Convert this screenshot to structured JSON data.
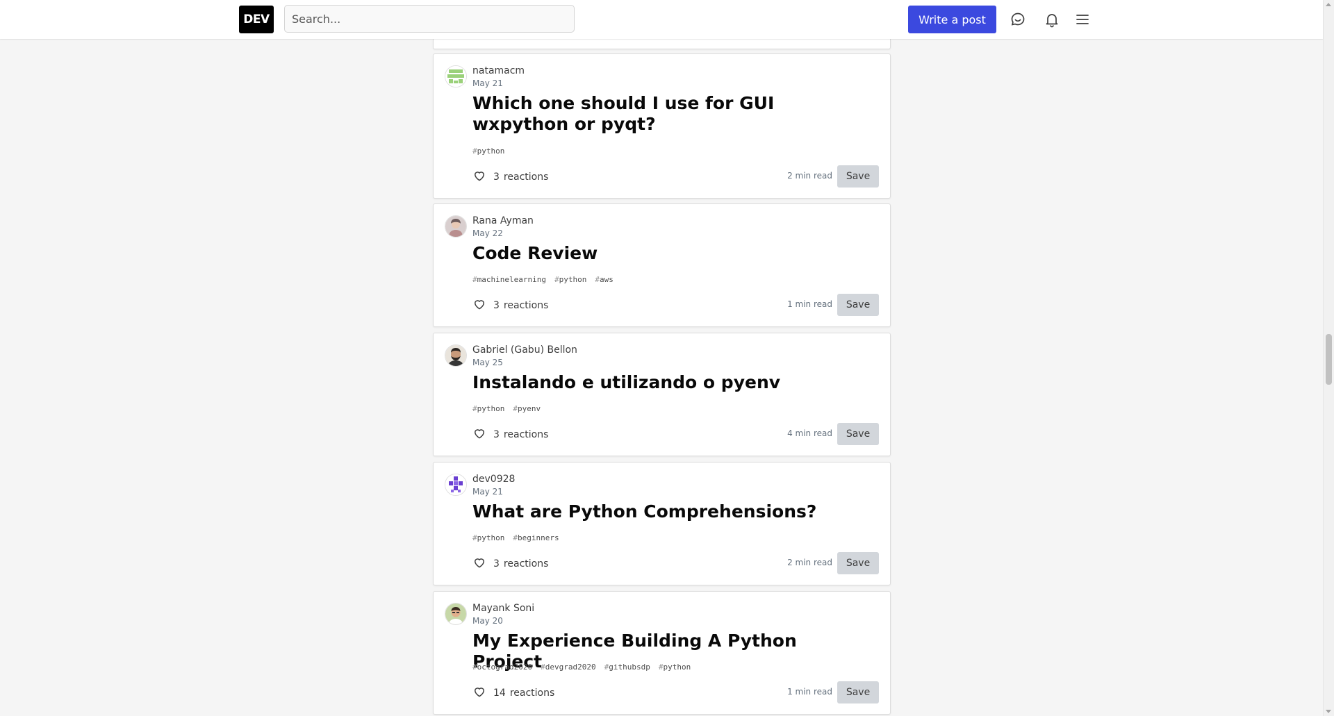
{
  "header": {
    "logo": "DEV",
    "search_placeholder": "Search...",
    "write_button": "Write a post",
    "icons": [
      "chat-icon",
      "bell-icon",
      "menu-icon"
    ]
  },
  "colors": {
    "accent": "#3b49df",
    "save_button_bg": "#d2d6db"
  },
  "posts": [
    {
      "author": "natamacm",
      "date": "May 21",
      "title": "Which one should I use for GUI wxpython or pyqt?",
      "tags": [
        "python"
      ],
      "reactions_count": "3",
      "reactions_label": "reactions",
      "read_time": "2 min read",
      "save_label": "Save"
    },
    {
      "author": "Rana Ayman",
      "date": "May 22",
      "title": "Code Review",
      "tags": [
        "machinelearning",
        "python",
        "aws"
      ],
      "reactions_count": "3",
      "reactions_label": "reactions",
      "read_time": "1 min read",
      "save_label": "Save"
    },
    {
      "author": "Gabriel (Gabu) Bellon",
      "date": "May 25",
      "title": "Instalando e utilizando o pyenv",
      "tags": [
        "python",
        "pyenv"
      ],
      "reactions_count": "3",
      "reactions_label": "reactions",
      "read_time": "4 min read",
      "save_label": "Save"
    },
    {
      "author": "dev0928",
      "date": "May 21",
      "title": "What are Python Comprehensions?",
      "tags": [
        "python",
        "beginners"
      ],
      "reactions_count": "3",
      "reactions_label": "reactions",
      "read_time": "2 min read",
      "save_label": "Save"
    },
    {
      "author": "Mayank Soni",
      "date": "May 20",
      "title": "My Experience Building A Python Project",
      "tags": [
        "octograd2020",
        "devgrad2020",
        "githubsdp",
        "python"
      ],
      "reactions_count": "14",
      "reactions_label": "reactions",
      "read_time": "1 min read",
      "save_label": "Save"
    }
  ]
}
